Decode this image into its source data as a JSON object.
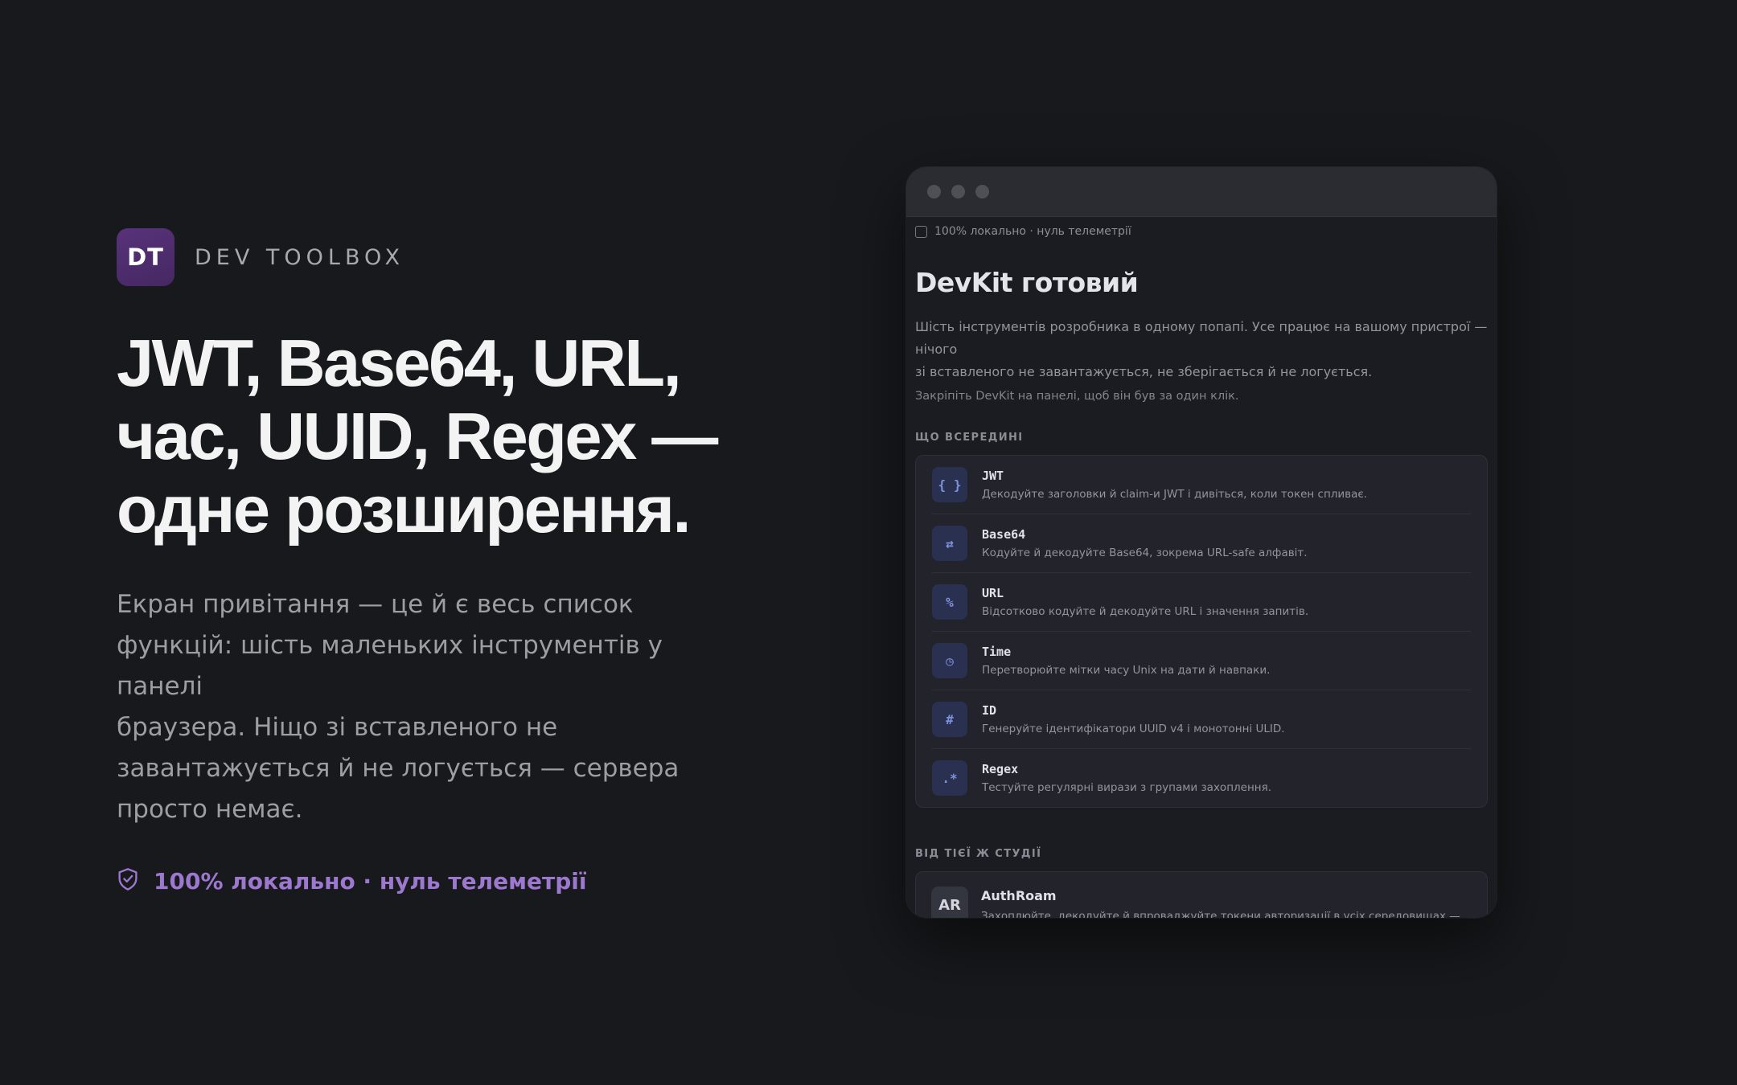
{
  "brand": {
    "logo_text": "DT",
    "name": "DEV TOOLBOX"
  },
  "hero": {
    "headline_lines": [
      "JWT, Base64, URL,",
      "час, UUID, Regex —",
      "одне розширення."
    ],
    "lead_lines": [
      "Екран привітання — це й є весь список",
      "функцій: шість маленьких інструментів у панелі",
      "браузера. Ніщо зі вставленого не",
      "завантажується й не логується — сервера",
      "просто немає."
    ],
    "badge_icon": "shield-check-icon",
    "badge_text": "100% локально · нуль телеметрії"
  },
  "popup": {
    "topline_text": "100% локально · нуль телеметрії",
    "title": "DevKit готовий",
    "description_lines": [
      "Шість інструментів розробника в одному попапі. Усе працює на вашому пристрої — нічого",
      "зі вставленого не завантажується, не зберігається й не логується."
    ],
    "hint": "Закріпіть DevKit на панелі, щоб він був за один клік.",
    "tools_label": "ЩО ВСЕРЕДИНІ",
    "tools": [
      {
        "icon": "{ }",
        "name": "JWT",
        "desc": "Декодуйте заголовки й claim-и JWT і дивіться, коли токен спливає."
      },
      {
        "icon": "⇄",
        "name": "Base64",
        "desc": "Кодуйте й декодуйте Base64, зокрема URL-safe алфавіт."
      },
      {
        "icon": "%",
        "name": "URL",
        "desc": "Відсотково кодуйте й декодуйте URL і значення запитів."
      },
      {
        "icon": "◷",
        "name": "Time",
        "desc": "Перетворюйте мітки часу Unix на дати й навпаки."
      },
      {
        "icon": "#",
        "name": "ID",
        "desc": "Генеруйте ідентифікатори UUID v4 і монотонні ULID."
      },
      {
        "icon": ".*",
        "name": "Regex",
        "desc": "Тестуйте регулярні вирази з групами захоплення."
      }
    ],
    "studio_label": "ВІД ТІЄЇ Ж СТУДІЇ",
    "studio": {
      "icon_text": "AR",
      "name": "AuthRoam",
      "desc": "Захоплюйте, декодуйте й впроваджуйте токени авторизації в усіх середовищах —"
    }
  },
  "colors": {
    "page_bg": "#18191c",
    "brand_purple": "#58327a",
    "accent_lavender": "#9d78cf",
    "tool_icon_bg": "#2a3150",
    "tool_icon_fg": "#7d93dd"
  }
}
